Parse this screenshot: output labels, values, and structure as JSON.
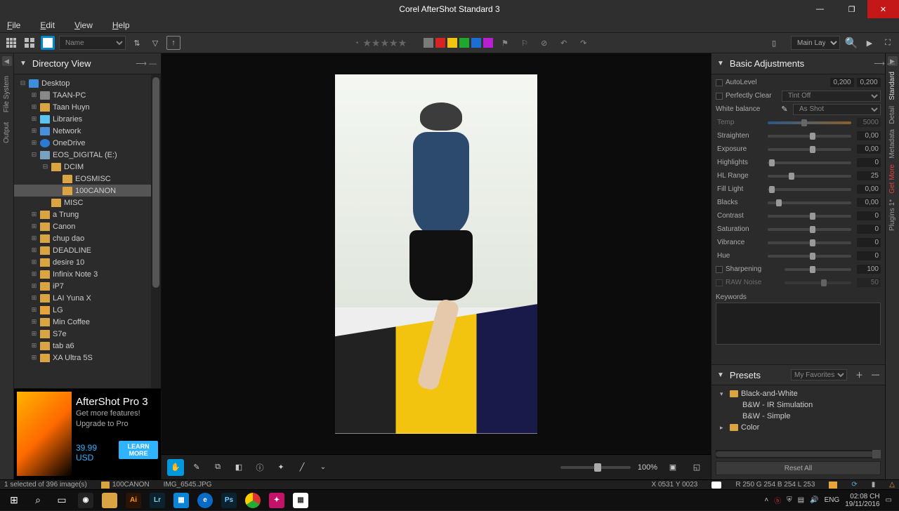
{
  "app": {
    "title": "Corel AfterShot Standard 3"
  },
  "menu": [
    "File",
    "Edit",
    "View",
    "Help"
  ],
  "toolbar": {
    "sort": "Name",
    "layer": "Main Layer",
    "colors": [
      "#7a7a7a",
      "#d72323",
      "#f2c40f",
      "#1fa82d",
      "#1b6fd4",
      "#b81fd0"
    ]
  },
  "leftRailTabs": [
    "File System",
    "Output"
  ],
  "leftPanel": {
    "title": "Directory View",
    "tree": [
      {
        "d": 0,
        "e": "-",
        "i": "desk",
        "t": "Desktop"
      },
      {
        "d": 1,
        "e": "+",
        "i": "pc",
        "t": "TAAN-PC"
      },
      {
        "d": 1,
        "e": "+",
        "i": "folder",
        "t": "Taan Huyn"
      },
      {
        "d": 1,
        "e": "+",
        "i": "lib",
        "t": "Libraries"
      },
      {
        "d": 1,
        "e": "+",
        "i": "net",
        "t": "Network"
      },
      {
        "d": 1,
        "e": "+",
        "i": "cloud",
        "t": "OneDrive"
      },
      {
        "d": 1,
        "e": "-",
        "i": "drive",
        "t": "EOS_DIGITAL (E:)"
      },
      {
        "d": 2,
        "e": "-",
        "i": "folder",
        "t": "DCIM"
      },
      {
        "d": 3,
        "e": "",
        "i": "folder",
        "t": "EOSMISC"
      },
      {
        "d": 3,
        "e": "",
        "i": "folder",
        "t": "100CANON",
        "sel": true
      },
      {
        "d": 2,
        "e": "",
        "i": "folder",
        "t": "MISC"
      },
      {
        "d": 1,
        "e": "+",
        "i": "folder",
        "t": "a Trung"
      },
      {
        "d": 1,
        "e": "+",
        "i": "folder",
        "t": "Canon"
      },
      {
        "d": 1,
        "e": "+",
        "i": "folder",
        "t": "chup dạo"
      },
      {
        "d": 1,
        "e": "+",
        "i": "folder",
        "t": "DEADLINE"
      },
      {
        "d": 1,
        "e": "+",
        "i": "folder",
        "t": "desire 10"
      },
      {
        "d": 1,
        "e": "+",
        "i": "folder",
        "t": "Infinix Note 3"
      },
      {
        "d": 1,
        "e": "+",
        "i": "folder",
        "t": "iP7"
      },
      {
        "d": 1,
        "e": "+",
        "i": "folder",
        "t": "LAI Yuna X"
      },
      {
        "d": 1,
        "e": "+",
        "i": "warn",
        "t": "LG"
      },
      {
        "d": 1,
        "e": "+",
        "i": "folder",
        "t": "Min Coffee"
      },
      {
        "d": 1,
        "e": "+",
        "i": "folder",
        "t": "S7e"
      },
      {
        "d": 1,
        "e": "+",
        "i": "folder",
        "t": "tab a6"
      },
      {
        "d": 1,
        "e": "+",
        "i": "folder",
        "t": "XA Ultra 5S"
      }
    ]
  },
  "promo": {
    "name": "AfterShot Pro 3",
    "tag1": "Get more features!",
    "tag2": "Upgrade to Pro",
    "price": "39.99 USD",
    "btn": "LEARN MORE"
  },
  "viewerTools": {
    "zoom": "100%"
  },
  "rightRailTabs": [
    "Standard",
    "Detail",
    "Metadata",
    "Get More",
    "Plugins 1*"
  ],
  "adjustments": {
    "title": "Basic Adjustments",
    "autolevel_lbl": "AutoLevel",
    "autolevel_a": "0,200",
    "autolevel_b": "0,200",
    "perfclear_lbl": "Perfectly Clear",
    "perfclear_opt": "Tint Off",
    "wb_lbl": "White balance",
    "wb_opt": "As Shot",
    "rows": [
      {
        "lbl": "Temp",
        "val": "5000",
        "pos": 40,
        "cls": "temp",
        "dim": true
      },
      {
        "lbl": "Straighten",
        "val": "0,00",
        "pos": 50
      },
      {
        "lbl": "Exposure",
        "val": "0,00",
        "pos": 50
      },
      {
        "lbl": "Highlights",
        "val": "0",
        "pos": 2
      },
      {
        "lbl": "HL Range",
        "val": "25",
        "pos": 25
      },
      {
        "lbl": "Fill Light",
        "val": "0,00",
        "pos": 2
      },
      {
        "lbl": "Blacks",
        "val": "0,00",
        "pos": 10
      },
      {
        "lbl": "Contrast",
        "val": "0",
        "pos": 50
      },
      {
        "lbl": "Saturation",
        "val": "0",
        "pos": 50
      },
      {
        "lbl": "Vibrance",
        "val": "0",
        "pos": 50
      },
      {
        "lbl": "Hue",
        "val": "0",
        "pos": 50
      }
    ],
    "sharp_lbl": "Sharpening",
    "sharp_val": "100",
    "raw_lbl": "RAW Noise",
    "raw_val": "50",
    "keywords_lbl": "Keywords"
  },
  "presets": {
    "title": "Presets",
    "filter": "My Favorites",
    "items": [
      {
        "d": 0,
        "e": "▾",
        "i": true,
        "t": "Black-and-White"
      },
      {
        "d": 1,
        "e": "",
        "i": false,
        "t": "B&W - IR Simulation"
      },
      {
        "d": 1,
        "e": "",
        "i": false,
        "t": "B&W - Simple"
      },
      {
        "d": 0,
        "e": "▸",
        "i": true,
        "t": "Color"
      }
    ],
    "reset": "Reset All"
  },
  "status": {
    "sel": "1 selected of 396 image(s)",
    "folder": "100CANON",
    "file": "IMG_6545.JPG",
    "coords": "X 0531  Y 0023",
    "rgb": "R    250     G    254     B    254     L    253"
  },
  "tray": {
    "lang": "ENG",
    "time": "02:08 CH",
    "date": "19/11/2016"
  }
}
